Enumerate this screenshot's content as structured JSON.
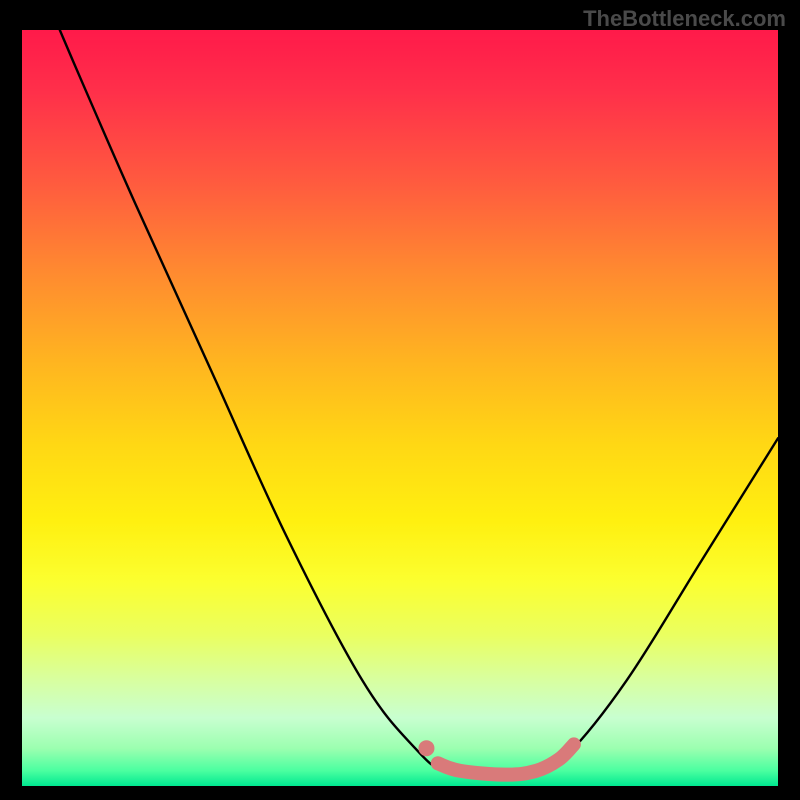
{
  "watermark": "TheBottleneck.com",
  "chart_data": {
    "type": "line",
    "title": "",
    "xlabel": "",
    "ylabel": "",
    "xlim": [
      0,
      100
    ],
    "ylim": [
      0,
      100
    ],
    "series": [
      {
        "name": "bottleneck-curve",
        "points": [
          {
            "x": 5,
            "y": 100
          },
          {
            "x": 8,
            "y": 93
          },
          {
            "x": 15,
            "y": 77
          },
          {
            "x": 25,
            "y": 55
          },
          {
            "x": 35,
            "y": 33
          },
          {
            "x": 45,
            "y": 14
          },
          {
            "x": 52,
            "y": 5
          },
          {
            "x": 56,
            "y": 2
          },
          {
            "x": 62,
            "y": 1.5
          },
          {
            "x": 68,
            "y": 2
          },
          {
            "x": 72,
            "y": 4
          },
          {
            "x": 80,
            "y": 14
          },
          {
            "x": 90,
            "y": 30
          },
          {
            "x": 100,
            "y": 46
          }
        ]
      },
      {
        "name": "highlight-segment",
        "color": "#d97a7a",
        "points": [
          {
            "x": 55,
            "y": 3
          },
          {
            "x": 58,
            "y": 2
          },
          {
            "x": 64,
            "y": 1.5
          },
          {
            "x": 68,
            "y": 2
          },
          {
            "x": 71,
            "y": 3.5
          },
          {
            "x": 73,
            "y": 5.5
          }
        ]
      }
    ],
    "gradient_stops": [
      {
        "pos": 0,
        "color": "#ff1a4a"
      },
      {
        "pos": 50,
        "color": "#ffd000"
      },
      {
        "pos": 100,
        "color": "#00e890"
      }
    ]
  }
}
